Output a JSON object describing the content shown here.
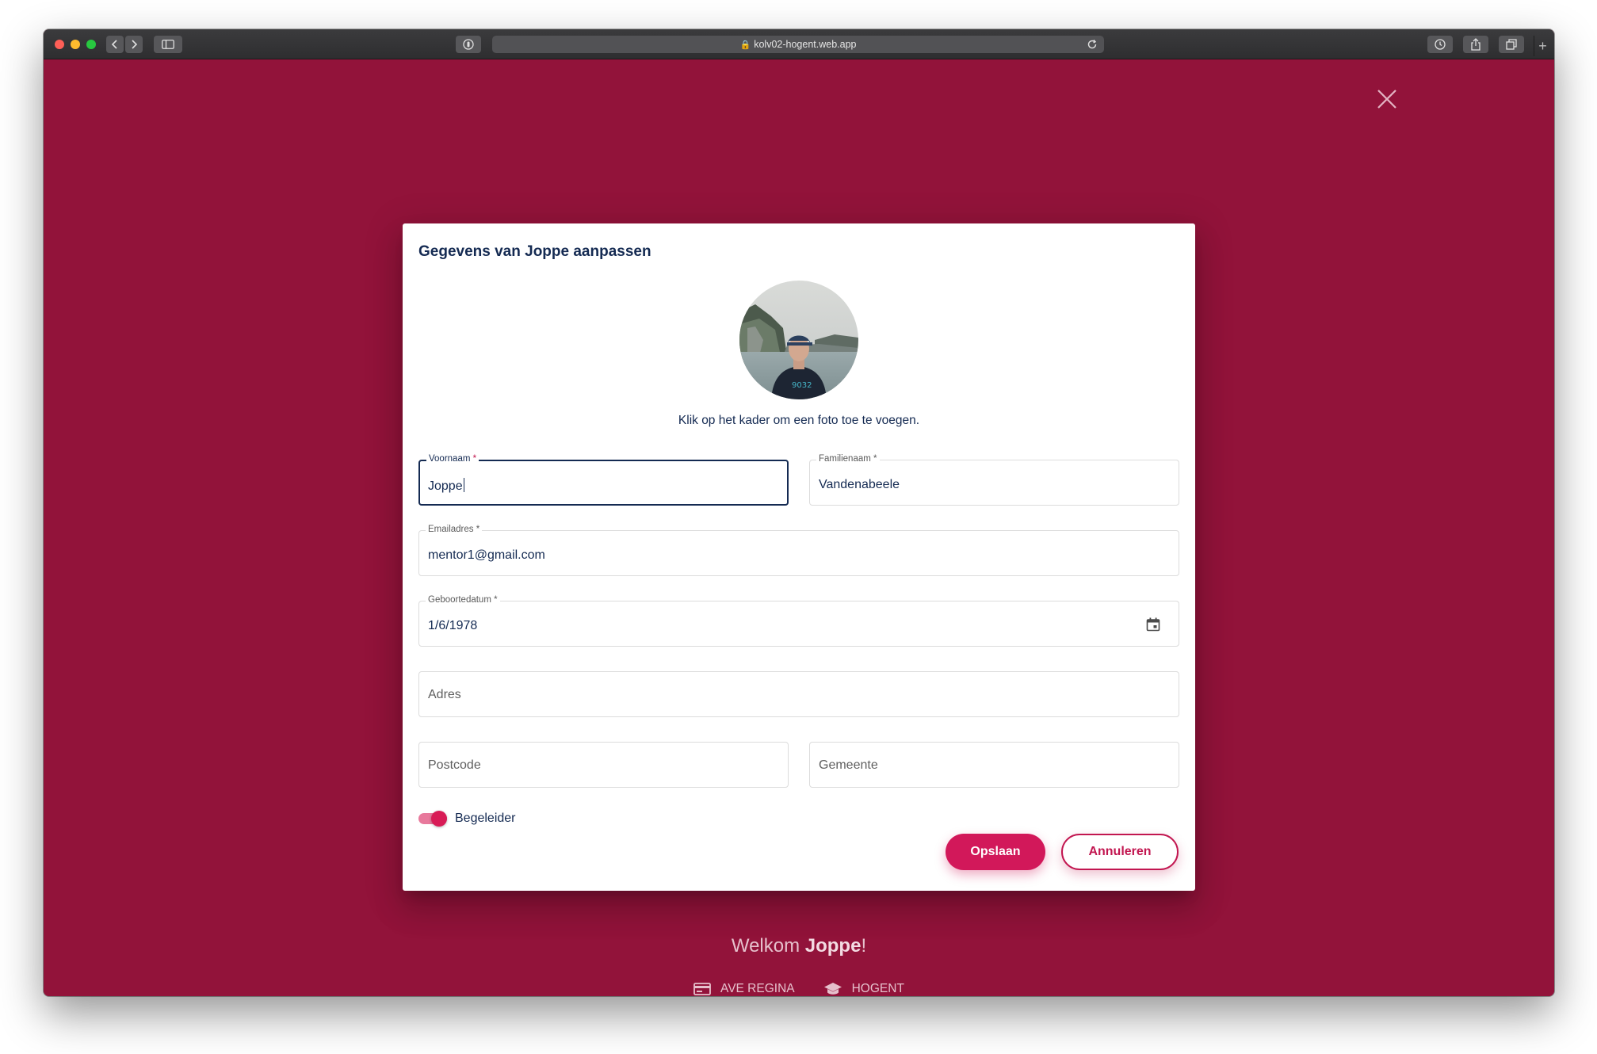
{
  "browser": {
    "url": "kolv02-hogent.web.app"
  },
  "dialog": {
    "title": "Gegevens van Joppe aanpassen",
    "photo_hint": "Klik op het kader om een foto toe te voegen.",
    "fields": {
      "voornaam": {
        "label": "Voornaam",
        "required_mark": "*",
        "value": "Joppe"
      },
      "familienaam": {
        "label": "Familienaam",
        "required_mark": "*",
        "value": "Vandenabeele"
      },
      "email": {
        "label": "Emailadres",
        "required_mark": "*",
        "value": "mentor1@gmail.com"
      },
      "geboortedatum": {
        "label": "Geboortedatum",
        "required_mark": "*",
        "value": "1/6/1978"
      },
      "adres": {
        "placeholder": "Adres",
        "value": ""
      },
      "postcode": {
        "placeholder": "Postcode",
        "value": ""
      },
      "gemeente": {
        "placeholder": "Gemeente",
        "value": ""
      }
    },
    "toggle": {
      "label": "Begeleider",
      "checked": true
    },
    "buttons": {
      "save": "Opslaan",
      "cancel": "Annuleren"
    }
  },
  "footer": {
    "welcome_prefix": "Welkom ",
    "welcome_name": "Joppe",
    "welcome_suffix": "!",
    "links": [
      {
        "label": "AVE REGINA",
        "icon": "card-icon"
      },
      {
        "label": "HOGENT",
        "icon": "school-cap-icon"
      }
    ]
  },
  "colors": {
    "background": "#92133a",
    "accent": "#d2185a",
    "text_primary": "#142a52"
  }
}
